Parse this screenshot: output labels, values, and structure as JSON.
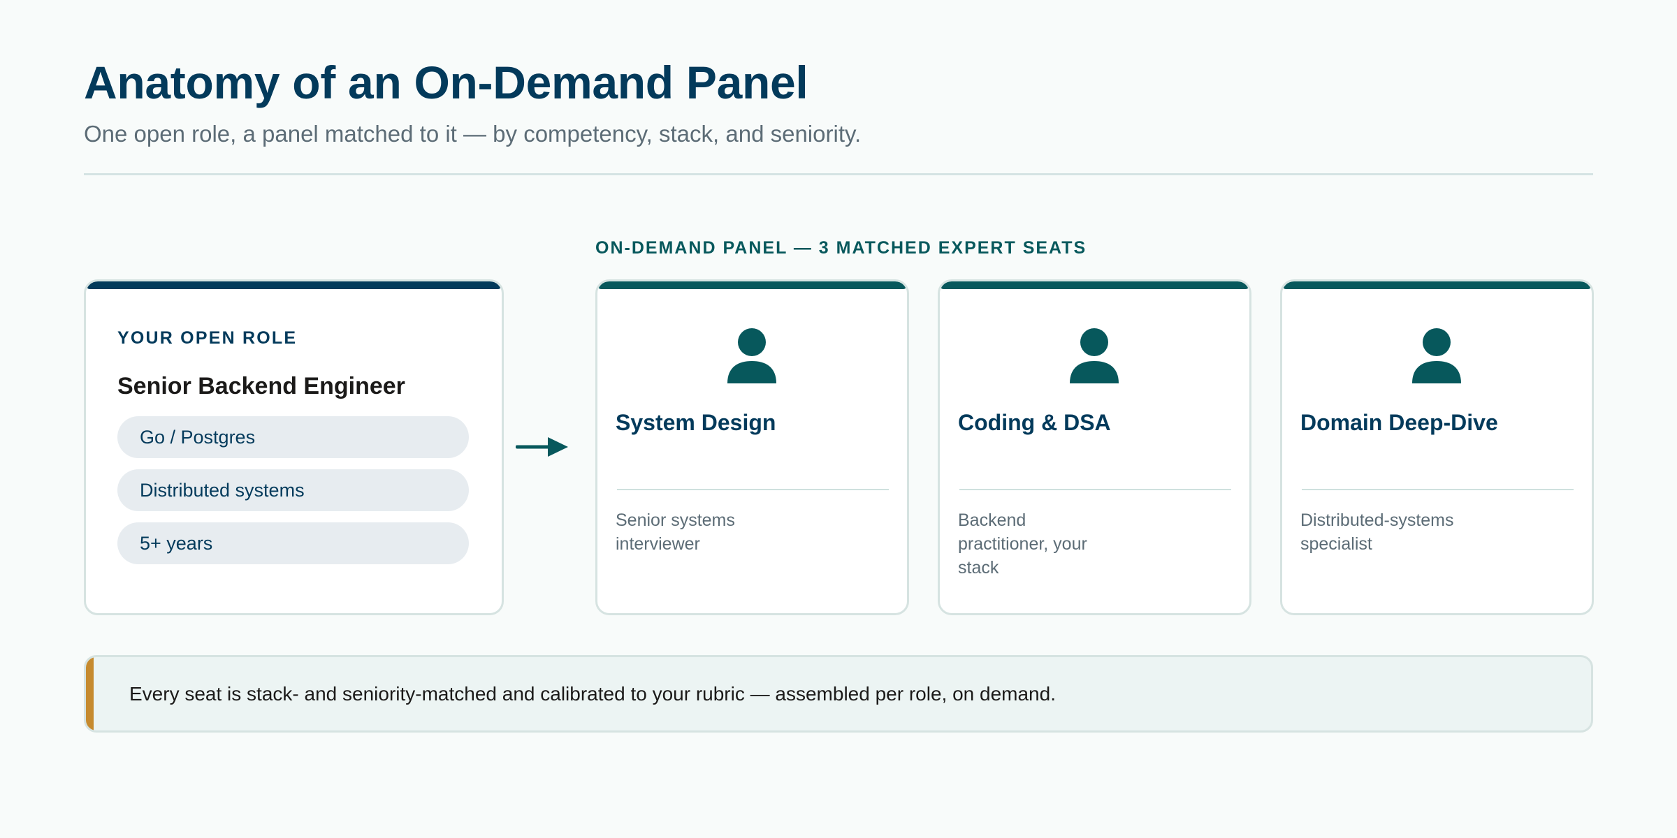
{
  "header": {
    "title": "Anatomy of an On-Demand Panel",
    "subtitle": "One open role, a panel matched to it — by competency, stack, and seniority."
  },
  "role_card": {
    "label": "YOUR OPEN ROLE",
    "title": "Senior Backend Engineer",
    "tags": [
      "Go / Postgres",
      "Distributed systems",
      "5+ years"
    ]
  },
  "panel": {
    "heading": "ON-DEMAND PANEL — 3 MATCHED EXPERT SEATS",
    "seats": [
      {
        "title": "System Design",
        "description": "Senior systems interviewer",
        "icon": "person-icon"
      },
      {
        "title": "Coding & DSA",
        "description": "Backend practitioner, your stack",
        "icon": "person-icon"
      },
      {
        "title": "Domain Deep-Dive",
        "description": "Distributed-systems specialist",
        "icon": "person-icon"
      }
    ]
  },
  "callout": {
    "text": "Every seat is stack- and seniority-matched and calibrated to your rubric — assembled per role, on demand."
  },
  "colors": {
    "navy": "#033a5b",
    "teal": "#07585c",
    "amber_accent": "#c68a2e",
    "page_background": "#f8fbfa",
    "tag_background": "#e7ecf0"
  }
}
